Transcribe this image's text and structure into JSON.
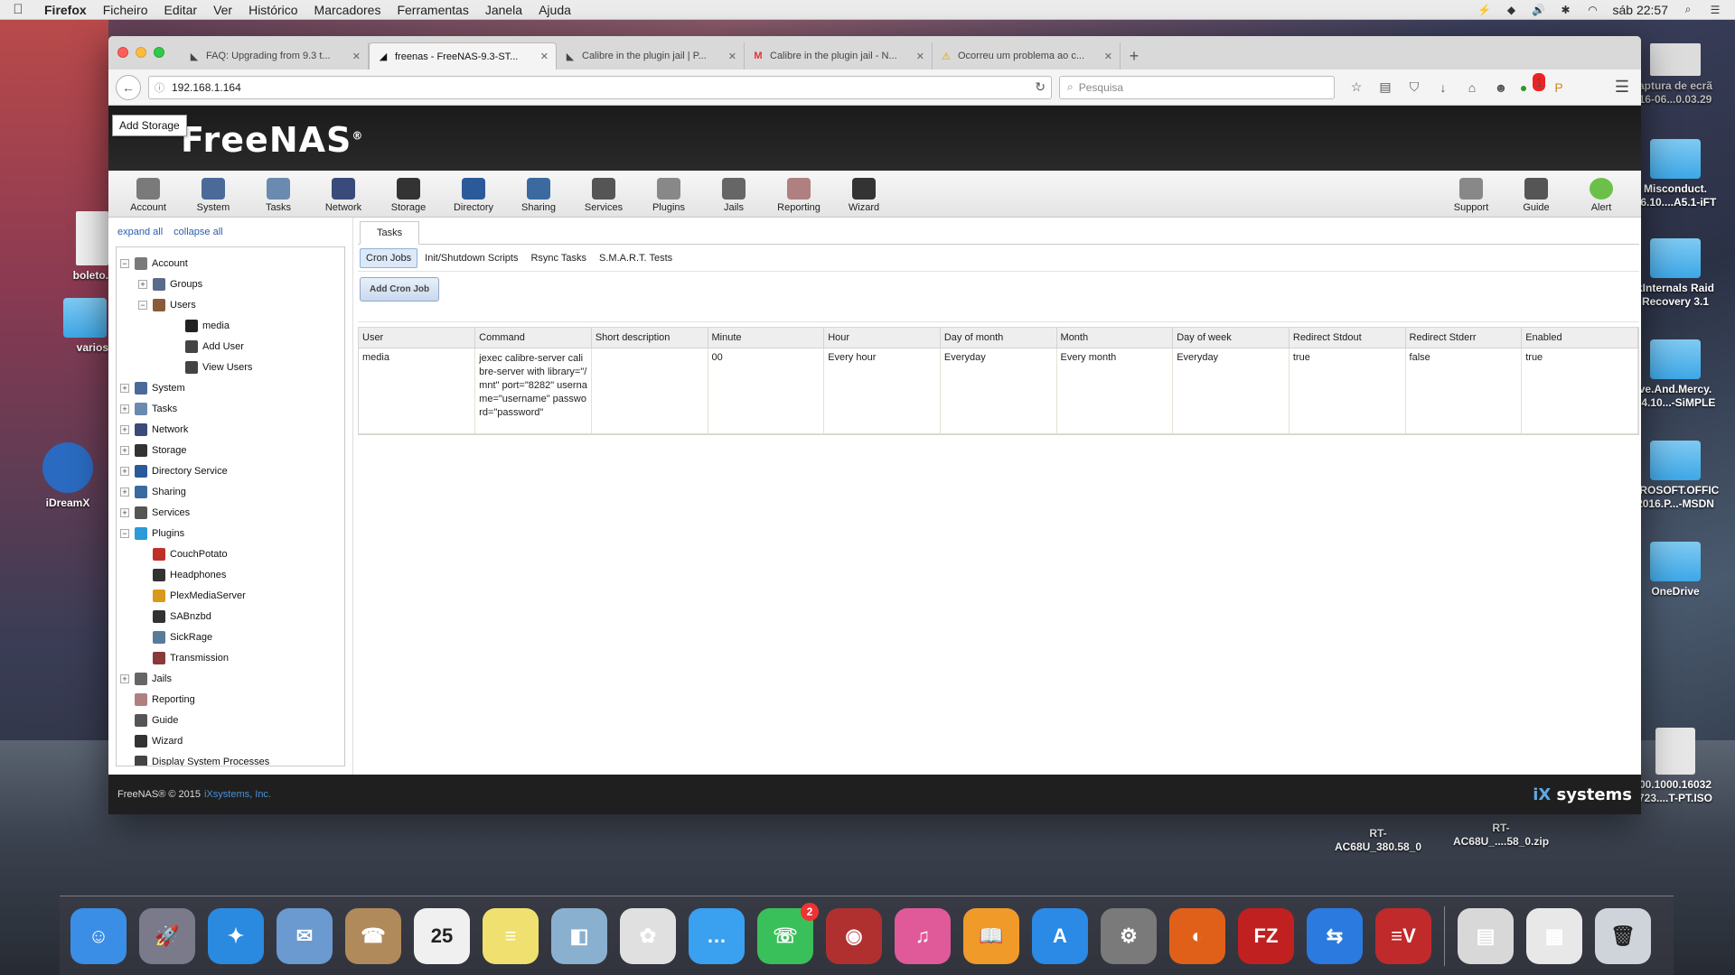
{
  "menubar": {
    "app": "Firefox",
    "items": [
      "Ficheiro",
      "Editar",
      "Ver",
      "Histórico",
      "Marcadores",
      "Ferramentas",
      "Janela",
      "Ajuda"
    ],
    "clock": "sáb 22:57"
  },
  "browser": {
    "tabs": [
      {
        "title": "FAQ: Upgrading from 9.3 t..."
      },
      {
        "title": "freenas - FreeNAS-9.3-ST..."
      },
      {
        "title": "Calibre in the plugin jail | P..."
      },
      {
        "title": "Calibre in the plugin jail - N..."
      },
      {
        "title": "Ocorreu um problema ao c..."
      }
    ],
    "url": "192.168.1.164",
    "search_placeholder": "Pesquisa",
    "notification_badge": "1"
  },
  "freenas": {
    "tooltip": "Add Storage",
    "logo": "FreeNAS",
    "toolbar": [
      {
        "label": "Account",
        "icon": "account-icon",
        "color": "#7a7a7a"
      },
      {
        "label": "System",
        "icon": "system-icon",
        "color": "#4a6a9a"
      },
      {
        "label": "Tasks",
        "icon": "tasks-icon",
        "color": "#6a8ab0"
      },
      {
        "label": "Network",
        "icon": "network-icon",
        "color": "#3a4a7a"
      },
      {
        "label": "Storage",
        "icon": "storage-icon",
        "color": "#333333"
      },
      {
        "label": "Directory",
        "icon": "directory-icon",
        "color": "#2a5a9a"
      },
      {
        "label": "Sharing",
        "icon": "sharing-icon",
        "color": "#3a6aa0"
      },
      {
        "label": "Services",
        "icon": "services-icon",
        "color": "#555555"
      },
      {
        "label": "Plugins",
        "icon": "plugins-icon",
        "color": "#888888"
      },
      {
        "label": "Jails",
        "icon": "jails-icon",
        "color": "#666666"
      },
      {
        "label": "Reporting",
        "icon": "reporting-icon",
        "color": "#b08080"
      },
      {
        "label": "Wizard",
        "icon": "wizard-icon",
        "color": "#333333"
      }
    ],
    "toolbar_right": [
      {
        "label": "Support",
        "icon": "support-icon",
        "color": "#888888"
      },
      {
        "label": "Guide",
        "icon": "guide-icon",
        "color": "#555555"
      },
      {
        "label": "Alert",
        "icon": "alert-icon",
        "color": "#6cc04a"
      }
    ],
    "expand_all": "expand all",
    "collapse_all": "collapse all",
    "tree": [
      {
        "label": "Account",
        "level": 0,
        "exp": "−",
        "color": "#7a7a7a"
      },
      {
        "label": "Groups",
        "level": 1,
        "exp": "+",
        "color": "#5a6a8a"
      },
      {
        "label": "Users",
        "level": 1,
        "exp": "−",
        "color": "#8a5a3a"
      },
      {
        "label": "media",
        "level": 2,
        "exp": "",
        "color": "#222222"
      },
      {
        "label": "Add User",
        "level": 2,
        "exp": "",
        "color": "#444444"
      },
      {
        "label": "View Users",
        "level": 2,
        "exp": "",
        "color": "#444444"
      },
      {
        "label": "System",
        "level": 0,
        "exp": "+",
        "color": "#4a6a9a"
      },
      {
        "label": "Tasks",
        "level": 0,
        "exp": "+",
        "color": "#6a8ab0"
      },
      {
        "label": "Network",
        "level": 0,
        "exp": "+",
        "color": "#3a4a7a"
      },
      {
        "label": "Storage",
        "level": 0,
        "exp": "+",
        "color": "#333333"
      },
      {
        "label": "Directory Service",
        "level": 0,
        "exp": "+",
        "color": "#2a5a9a"
      },
      {
        "label": "Sharing",
        "level": 0,
        "exp": "+",
        "color": "#3a6aa0"
      },
      {
        "label": "Services",
        "level": 0,
        "exp": "+",
        "color": "#555555"
      },
      {
        "label": "Plugins",
        "level": 0,
        "exp": "−",
        "color": "#2a9ad8"
      },
      {
        "label": "CouchPotato",
        "level": 1,
        "exp": "",
        "color": "#c0302a"
      },
      {
        "label": "Headphones",
        "level": 1,
        "exp": "",
        "color": "#333333"
      },
      {
        "label": "PlexMediaServer",
        "level": 1,
        "exp": "",
        "color": "#d89a1a"
      },
      {
        "label": "SABnzbd",
        "level": 1,
        "exp": "",
        "color": "#333333"
      },
      {
        "label": "SickRage",
        "level": 1,
        "exp": "",
        "color": "#5a7a9a"
      },
      {
        "label": "Transmission",
        "level": 1,
        "exp": "",
        "color": "#8a3a3a"
      },
      {
        "label": "Jails",
        "level": 0,
        "exp": "+",
        "color": "#666666"
      },
      {
        "label": "Reporting",
        "level": 0,
        "exp": "",
        "color": "#b08080"
      },
      {
        "label": "Guide",
        "level": 0,
        "exp": "",
        "color": "#555555"
      },
      {
        "label": "Wizard",
        "level": 0,
        "exp": "",
        "color": "#333333"
      },
      {
        "label": "Display System Processes",
        "level": 0,
        "exp": "",
        "color": "#444444"
      }
    ],
    "main_tab": "Tasks",
    "subtabs": [
      "Cron Jobs",
      "Init/Shutdown Scripts",
      "Rsync Tasks",
      "S.M.A.R.T. Tests"
    ],
    "add_button": "Add Cron Job",
    "columns": [
      "User",
      "Command",
      "Short description",
      "Minute",
      "Hour",
      "Day of month",
      "Month",
      "Day of week",
      "Redirect Stdout",
      "Redirect Stderr",
      "Enabled"
    ],
    "rows": [
      [
        "media",
        "jexec calibre-server calibre-server with library=\"/mnt\" port=\"8282\" username=\"username\" password=\"password\"",
        "",
        "00",
        "Every hour",
        "Everyday",
        "Every month",
        "Everyday",
        "true",
        "false",
        "true"
      ]
    ],
    "footer": "FreeNAS® © 2015",
    "footer_link": "iXsystems, Inc.",
    "footer_logo_a": "iX",
    "footer_logo_b": "systems"
  },
  "desktop": {
    "icons": [
      {
        "label": "aptura de ecrã\n16-06...0.03.29",
        "kind": "file"
      },
      {
        "label": "Misconduct.\n16.10....A5.1-iFT",
        "kind": "folder"
      },
      {
        "label": "kInternals Raid\nRecovery 3.1",
        "kind": "folder"
      },
      {
        "label": "ve.And.Mercy.\n14.10...-SiMPLE",
        "kind": "folder"
      },
      {
        "label": "CROSOFT.OFFIC\n2016.P...-MSDN",
        "kind": "folder"
      },
      {
        "label": "OneDrive",
        "kind": "folder"
      },
      {
        "label": "00.1000.16032\n723....T-PT.ISO",
        "kind": "drive"
      },
      {
        "label": "RT-\nAC68U_380.58_0",
        "kind": "none"
      },
      {
        "label": "RT-\nAC68U_....58_0.zip",
        "kind": "none"
      },
      {
        "label": "boleto.",
        "kind": "file"
      },
      {
        "label": "varios",
        "kind": "folder"
      },
      {
        "label": "iDreamX",
        "kind": "app"
      }
    ],
    "dock": [
      {
        "name": "finder",
        "color": "#3a8ee6",
        "glyph": "☺",
        "badge": ""
      },
      {
        "name": "launchpad",
        "color": "#7a7a8a",
        "glyph": "🚀",
        "badge": ""
      },
      {
        "name": "safari",
        "color": "#2a8ae0",
        "glyph": "✦",
        "badge": ""
      },
      {
        "name": "mail",
        "color": "#6a9ad0",
        "glyph": "✉",
        "badge": ""
      },
      {
        "name": "contacts",
        "color": "#b08a5a",
        "glyph": "☎",
        "badge": ""
      },
      {
        "name": "calendar",
        "color": "#f0f0f0",
        "glyph": "25",
        "badge": ""
      },
      {
        "name": "notes",
        "color": "#f0e070",
        "glyph": "≡",
        "badge": ""
      },
      {
        "name": "preview",
        "color": "#8ab0d0",
        "glyph": "◧",
        "badge": ""
      },
      {
        "name": "photos",
        "color": "#e0e0e0",
        "glyph": "✿",
        "badge": ""
      },
      {
        "name": "messages",
        "color": "#3aa0f0",
        "glyph": "…",
        "badge": ""
      },
      {
        "name": "facetime",
        "color": "#3ac05a",
        "glyph": "☏",
        "badge": "2"
      },
      {
        "name": "photo-booth",
        "color": "#b03030",
        "glyph": "◉",
        "badge": ""
      },
      {
        "name": "itunes",
        "color": "#e05a9a",
        "glyph": "♫",
        "badge": ""
      },
      {
        "name": "ibooks",
        "color": "#f09a2a",
        "glyph": "📖",
        "badge": ""
      },
      {
        "name": "app-store",
        "color": "#2a8ae6",
        "glyph": "A",
        "badge": ""
      },
      {
        "name": "system-preferences",
        "color": "#7a7a7a",
        "glyph": "⚙",
        "badge": ""
      },
      {
        "name": "firefox",
        "color": "#e0601a",
        "glyph": "◐",
        "badge": ""
      },
      {
        "name": "filezilla",
        "color": "#c02020",
        "glyph": "FZ",
        "badge": ""
      },
      {
        "name": "teamviewer",
        "color": "#2a7ae0",
        "glyph": "⇆",
        "badge": ""
      },
      {
        "name": "evernote",
        "color": "#c02a2a",
        "glyph": "≡V",
        "badge": ""
      },
      {
        "name": "downloads-stack",
        "color": "#d8d8d8",
        "glyph": "▤",
        "badge": ""
      },
      {
        "name": "documents-stack",
        "color": "#e8e8e8",
        "glyph": "▦",
        "badge": ""
      },
      {
        "name": "trash",
        "color": "#cfd4da",
        "glyph": "🗑",
        "badge": ""
      }
    ]
  }
}
